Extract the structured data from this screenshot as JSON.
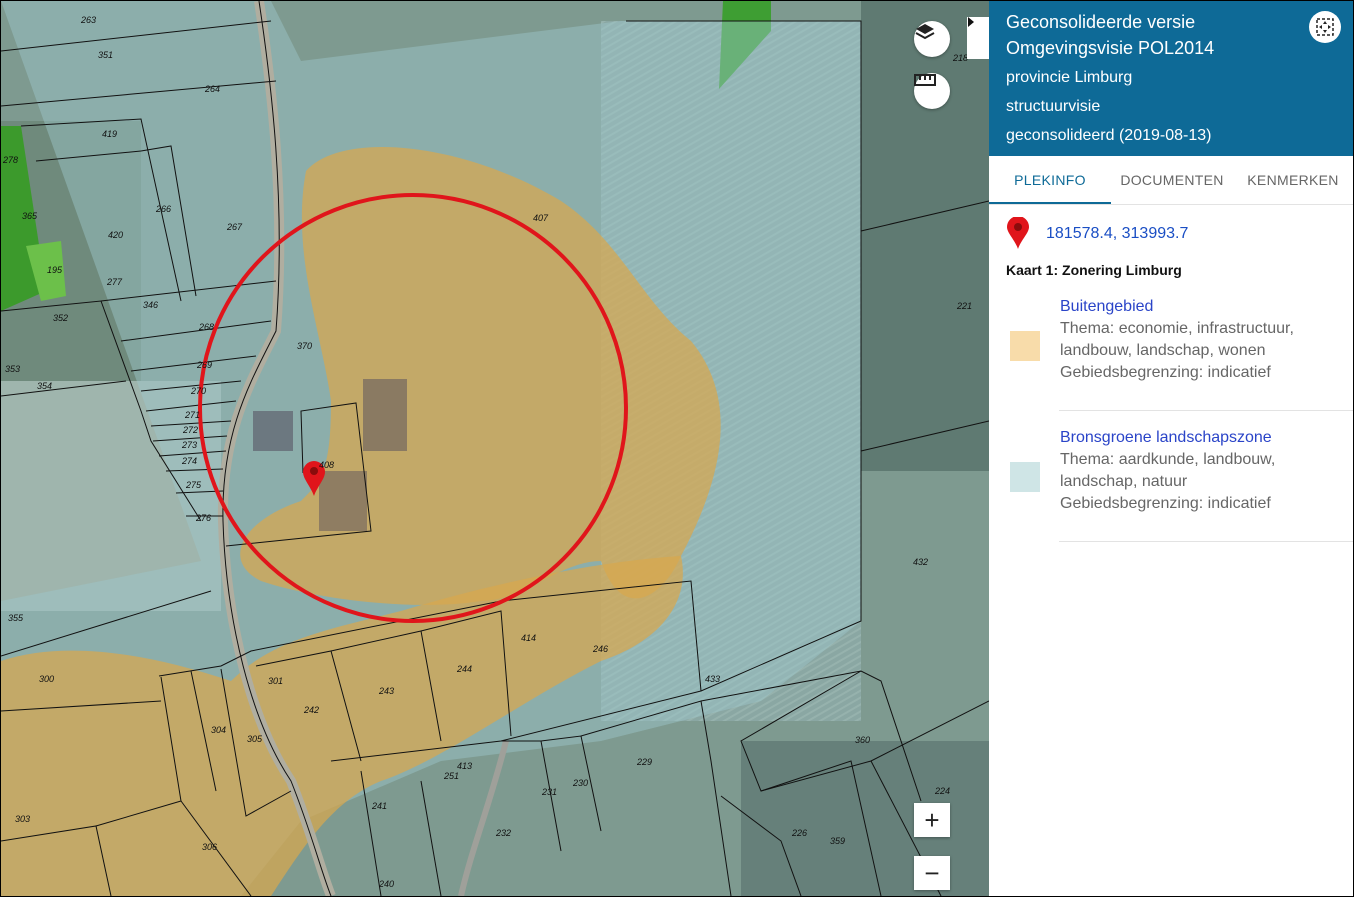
{
  "map": {
    "parcel_labels": [
      "263",
      "351",
      "264",
      "419",
      "365",
      "420",
      "266",
      "267",
      "195",
      "277",
      "346",
      "352",
      "353",
      "354",
      "268",
      "370",
      "269",
      "270",
      "271",
      "272",
      "273",
      "274",
      "275",
      "276",
      "408",
      "407",
      "221",
      "355",
      "300",
      "301",
      "304",
      "305",
      "242",
      "243",
      "244",
      "414",
      "246",
      "303",
      "306",
      "241",
      "251",
      "413",
      "231",
      "230",
      "229",
      "232",
      "240",
      "226",
      "359",
      "360",
      "224",
      "432",
      "433",
      "218",
      "278"
    ],
    "overlay_colors": {
      "buitengebied": "#d8a84e",
      "bronsgroen": "#9ec8cc"
    },
    "search_circle_color": "#e0151b",
    "marker_color": "#e0151b"
  },
  "controls": {
    "layers_icon": "layers-icon",
    "measure_icon": "ruler-icon",
    "zoom_in": "+",
    "zoom_out": "−",
    "collapse_icon": "caret-right-icon"
  },
  "panel": {
    "title": "Geconsolideerde versie Omgevingsvisie POL2014",
    "authority": "provincie Limburg",
    "doc_type": "structuurvisie",
    "status": "geconsolideerd (2019-08-13)",
    "focus_icon": "focus-icon",
    "tabs": [
      {
        "label": "PLEKINFO"
      },
      {
        "label": "DOCUMENTEN"
      },
      {
        "label": "KENMERKEN"
      }
    ],
    "coordinates": "181578.4, 313993.7",
    "map_title": "Kaart 1: Zonering Limburg",
    "legend": [
      {
        "name": "Buitengebied",
        "thema": "Thema: economie, infrastructuur,",
        "thema2": "landbouw, landschap, wonen",
        "begrenzing": "Gebiedsbegrenzing: indicatief",
        "color": "#f8dcaa"
      },
      {
        "name": "Bronsgroene landschapszone",
        "thema": "Thema: aardkunde, landbouw,",
        "thema2": "landschap, natuur",
        "begrenzing": "Gebiedsbegrenzing: indicatief",
        "color": "#cfe5e6"
      }
    ]
  }
}
